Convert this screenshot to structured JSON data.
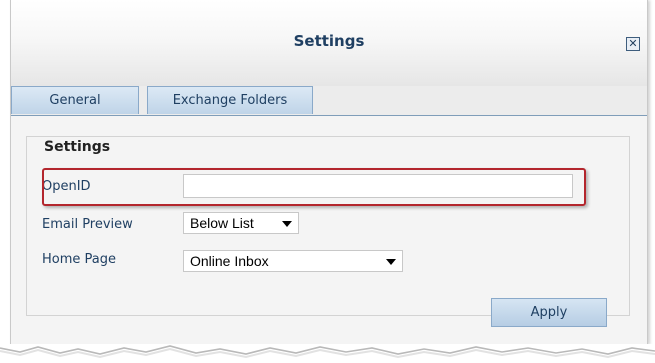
{
  "dialog": {
    "title": "Settings",
    "close_label": "✕"
  },
  "tabs": [
    {
      "label": "General"
    },
    {
      "label": "Exchange Folders"
    }
  ],
  "settings_group": {
    "legend": "Settings",
    "openid": {
      "label": "OpenID",
      "value": "",
      "placeholder": ""
    },
    "email_preview": {
      "label": "Email Preview",
      "selected": "Below List"
    },
    "home_page": {
      "label": "Home Page",
      "selected": "Online Inbox"
    }
  },
  "actions": {
    "apply_label": "Apply"
  },
  "colors": {
    "highlight": "#b3262d",
    "title_text": "#1f3f62",
    "tab_fill": "#bfd4e8",
    "panel_bg": "#f4f4f4"
  }
}
